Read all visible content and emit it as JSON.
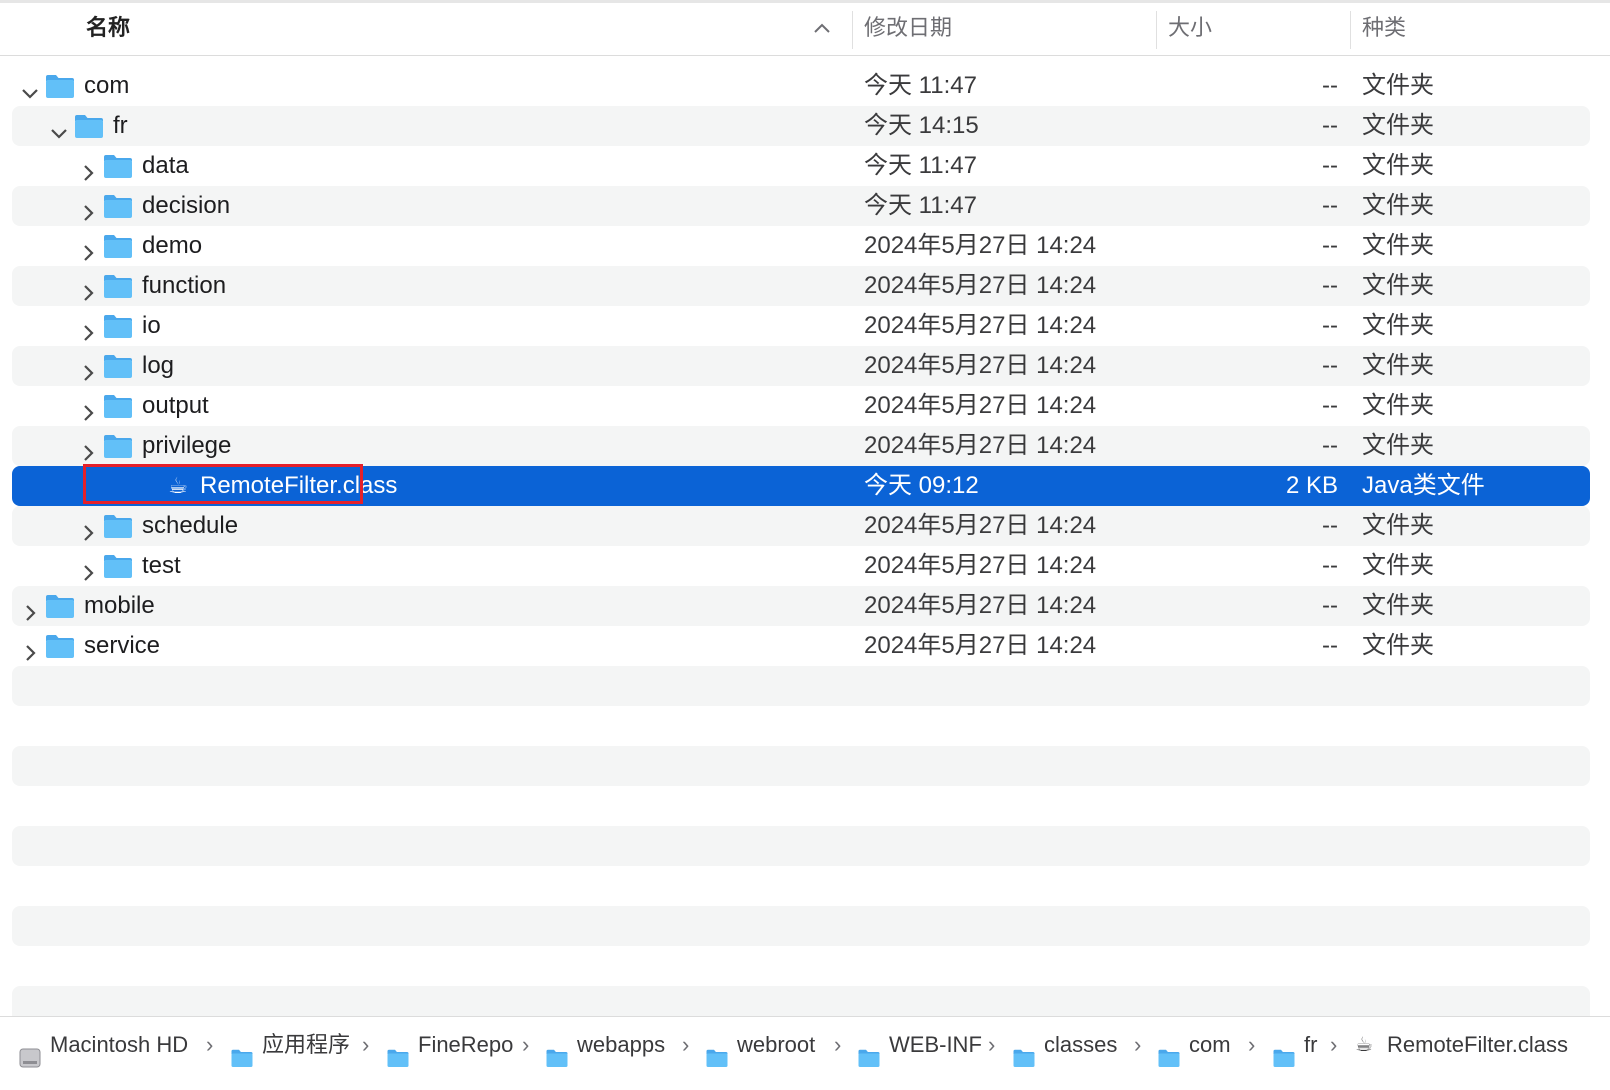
{
  "columns": {
    "name": "名称",
    "date": "修改日期",
    "size": "大小",
    "kind": "种类"
  },
  "rows": [
    {
      "name": "com",
      "date": "今天 11:47",
      "size": "--",
      "kind": "文件夹",
      "icon": "folder-icon",
      "disclosure": "expanded"
    },
    {
      "name": "fr",
      "date": "今天 14:15",
      "size": "--",
      "kind": "文件夹",
      "icon": "folder-icon",
      "disclosure": "expanded"
    },
    {
      "name": "data",
      "date": "今天 11:47",
      "size": "--",
      "kind": "文件夹",
      "icon": "folder-icon",
      "disclosure": "collapsed"
    },
    {
      "name": "decision",
      "date": "今天 11:47",
      "size": "--",
      "kind": "文件夹",
      "icon": "folder-icon",
      "disclosure": "collapsed"
    },
    {
      "name": "demo",
      "date": "2024年5月27日 14:24",
      "size": "--",
      "kind": "文件夹",
      "icon": "folder-icon",
      "disclosure": "collapsed"
    },
    {
      "name": "function",
      "date": "2024年5月27日 14:24",
      "size": "--",
      "kind": "文件夹",
      "icon": "folder-icon",
      "disclosure": "collapsed"
    },
    {
      "name": "io",
      "date": "2024年5月27日 14:24",
      "size": "--",
      "kind": "文件夹",
      "icon": "folder-icon",
      "disclosure": "collapsed"
    },
    {
      "name": "log",
      "date": "2024年5月27日 14:24",
      "size": "--",
      "kind": "文件夹",
      "icon": "folder-icon",
      "disclosure": "collapsed"
    },
    {
      "name": "output",
      "date": "2024年5月27日 14:24",
      "size": "--",
      "kind": "文件夹",
      "icon": "folder-icon",
      "disclosure": "collapsed"
    },
    {
      "name": "privilege",
      "date": "2024年5月27日 14:24",
      "size": "--",
      "kind": "文件夹",
      "icon": "folder-icon",
      "disclosure": "collapsed"
    },
    {
      "name": "RemoteFilter.class",
      "date": "今天 09:12",
      "size": "2 KB",
      "kind": "Java类文件",
      "icon": "java-coffee-icon",
      "disclosure": "none",
      "selected": true
    },
    {
      "name": "schedule",
      "date": "2024年5月27日 14:24",
      "size": "--",
      "kind": "文件夹",
      "icon": "folder-icon",
      "disclosure": "collapsed"
    },
    {
      "name": "test",
      "date": "2024年5月27日 14:24",
      "size": "--",
      "kind": "文件夹",
      "icon": "folder-icon",
      "disclosure": "collapsed"
    },
    {
      "name": "mobile",
      "date": "2024年5月27日 14:24",
      "size": "--",
      "kind": "文件夹",
      "icon": "folder-icon",
      "disclosure": "collapsed"
    },
    {
      "name": "service",
      "date": "2024年5月27日 14:24",
      "size": "--",
      "kind": "文件夹",
      "icon": "folder-icon",
      "disclosure": "collapsed"
    }
  ],
  "path_bar": [
    {
      "label": "Macintosh HD",
      "icon": "hard-drive-icon"
    },
    {
      "label": "应用程序",
      "icon": "applications-folder-icon"
    },
    {
      "label": "FineRepo",
      "icon": "folder-icon"
    },
    {
      "label": "webapps",
      "icon": "folder-icon"
    },
    {
      "label": "webroot",
      "icon": "folder-icon"
    },
    {
      "label": "WEB-INF",
      "icon": "folder-icon"
    },
    {
      "label": "classes",
      "icon": "folder-icon"
    },
    {
      "label": "com",
      "icon": "folder-icon"
    },
    {
      "label": "fr",
      "icon": "folder-icon"
    },
    {
      "label": "RemoteFilter.class",
      "icon": "java-coffee-icon"
    }
  ],
  "colors": {
    "selection": "#0b63d6",
    "highlight_box": "#e5202a",
    "folder": "#5ab8f5"
  }
}
